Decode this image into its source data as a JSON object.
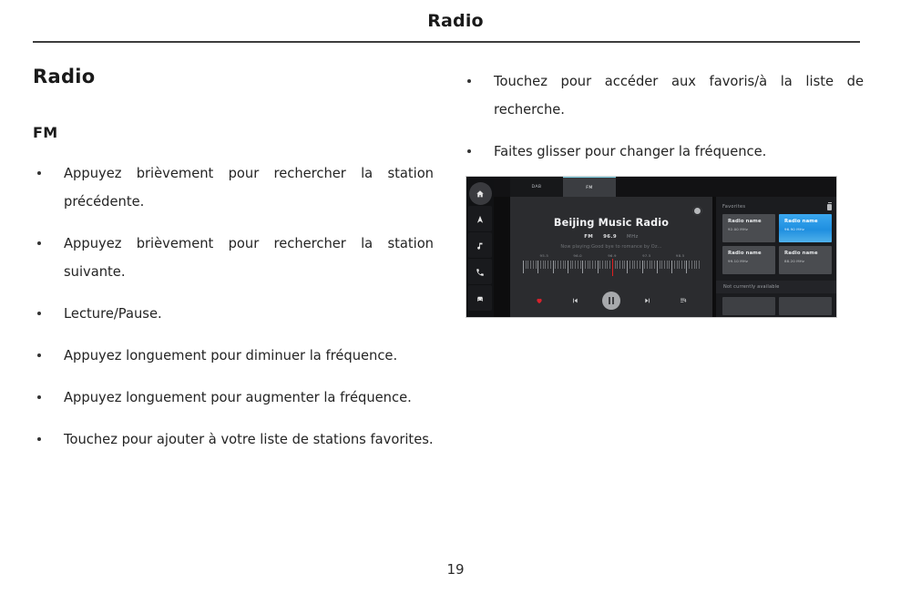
{
  "header": {
    "title": "Radio"
  },
  "footer": {
    "page_number": "19"
  },
  "left_column": {
    "section_title": "Radio",
    "subsection_title": "FM",
    "bullets": [
      "Appuyez brièvement pour rechercher la station précédente.",
      "Appuyez brièvement pour rechercher la station suivante.",
      "Lecture/Pause.",
      "Appuyez longuement pour diminuer la fréquence.",
      "Appuyez longuement pour augmenter la fréquence.",
      "Touchez pour ajouter à votre liste de stations favorites."
    ]
  },
  "right_column": {
    "bullets": [
      "Touchez pour accéder aux favoris/à la liste de recherche.",
      "Faites glisser pour changer la fréquence."
    ]
  },
  "device_screenshot": {
    "sidebar": [
      {
        "icon": "home-icon",
        "active": true
      },
      {
        "icon": "navigation-icon",
        "active": false
      },
      {
        "icon": "music-note-icon",
        "active": false
      },
      {
        "icon": "phone-icon",
        "active": false
      },
      {
        "icon": "car-icon",
        "active": false
      }
    ],
    "tabs": [
      {
        "label": "DAB",
        "selected": false
      },
      {
        "label": "FM",
        "selected": true
      }
    ],
    "now_playing": {
      "station_name": "Beijing Music Radio",
      "band": "FM",
      "frequency": "96.9",
      "unit": "MHz",
      "track_info": "Now playing:Good bye to romance by Oz...",
      "settings_icon": "gear-icon"
    },
    "dial": {
      "tick_labels": [
        "95.5",
        "96.0",
        "96.9",
        "97.5",
        "98.5"
      ],
      "needle_frequency": "96.9"
    },
    "controls": [
      {
        "icon": "favorite-heart-icon",
        "label": "Favori"
      },
      {
        "icon": "previous-track-icon",
        "label": "Précédent"
      },
      {
        "icon": "pause-icon",
        "label": "Pause"
      },
      {
        "icon": "next-track-icon",
        "label": "Suivant"
      },
      {
        "icon": "station-list-icon",
        "label": "Liste"
      }
    ],
    "favorites_panel": {
      "title": "Favorites",
      "delete_icon": "trash-icon",
      "tiles": [
        {
          "name": "Radio name",
          "frequency": "92.00 MHz",
          "selected": false
        },
        {
          "name": "Radio name",
          "frequency": "96.90 MHz",
          "selected": true
        },
        {
          "name": "Radio name",
          "frequency": "99.10 MHz",
          "selected": false
        },
        {
          "name": "Radio name",
          "frequency": "88.20 MHz",
          "selected": false
        }
      ],
      "status_text": "Not currently available"
    },
    "colors": {
      "accent_blue": "#2a9bea",
      "heart_red": "#d8222c",
      "needle_red": "#e02020",
      "tab_highlight": "#7fd2e6",
      "panel_bg": "#2b2c2f"
    }
  }
}
